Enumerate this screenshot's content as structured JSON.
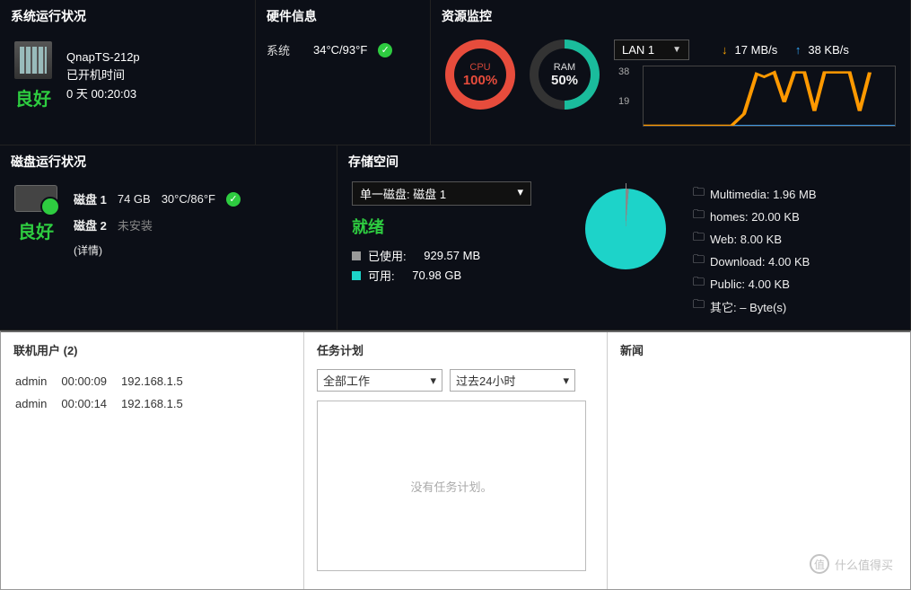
{
  "system_status": {
    "title": "系统运行状况",
    "model": "QnapTS-212p",
    "uptime_label": "已开机时间",
    "uptime_value": "0 天 00:20:03",
    "status_text": "良好"
  },
  "hardware": {
    "title": "硬件信息",
    "label": "系统",
    "temp": "34°C/93°F"
  },
  "resource": {
    "title": "资源监控",
    "cpu_label": "CPU",
    "cpu_value": "100%",
    "ram_label": "RAM",
    "ram_value": "50%",
    "lan_selector": "LAN 1",
    "down_speed": "17 MB/s",
    "up_speed": "38 KB/s",
    "y_top": "38",
    "y_mid": "19"
  },
  "disk": {
    "title": "磁盘运行状况",
    "status_text": "良好",
    "details": "(详情)",
    "rows": [
      {
        "name": "磁盘 1",
        "size": "74 GB",
        "temp": "30°C/86°F",
        "ok": true
      },
      {
        "name": "磁盘 2",
        "size": "未安装",
        "temp": "",
        "ok": false
      }
    ]
  },
  "storage": {
    "title": "存储空间",
    "selector": "单一磁盘: 磁盘 1",
    "ready": "就绪",
    "used_label": "已使用:",
    "used_value": "929.57 MB",
    "free_label": "可用:",
    "free_value": "70.98 GB",
    "folders": [
      "Multimedia: 1.96 MB",
      "homes: 20.00 KB",
      "Web: 8.00 KB",
      "Download: 4.00 KB",
      "Public: 4.00 KB",
      "其它: – Byte(s)"
    ]
  },
  "users": {
    "title": "联机用户 (2)",
    "rows": [
      {
        "name": "admin",
        "time": "00:00:09",
        "ip": "192.168.1.5"
      },
      {
        "name": "admin",
        "time": "00:00:14",
        "ip": "192.168.1.5"
      }
    ]
  },
  "tasks": {
    "title": "任务计划",
    "dd1": "全部工作",
    "dd2": "过去24小时",
    "empty": "没有任务计划。"
  },
  "news": {
    "title": "新闻"
  },
  "watermark": {
    "text": "什么值得买",
    "badge": "值"
  },
  "chart_data": {
    "type": "line",
    "title": "LAN 1 throughput",
    "ylabel": "MB/s",
    "ylim": [
      0,
      38
    ],
    "series": [
      {
        "name": "download",
        "color": "#f90",
        "values": [
          0,
          0,
          0,
          0,
          0,
          0,
          8,
          34,
          32,
          36,
          16,
          34,
          34,
          10,
          34,
          34,
          34,
          10
        ]
      },
      {
        "name": "upload",
        "color": "#4af",
        "values": [
          0,
          0,
          0,
          0,
          0,
          0,
          0,
          0,
          0,
          0,
          0,
          0,
          0,
          0,
          0,
          0,
          0,
          0
        ]
      }
    ]
  }
}
